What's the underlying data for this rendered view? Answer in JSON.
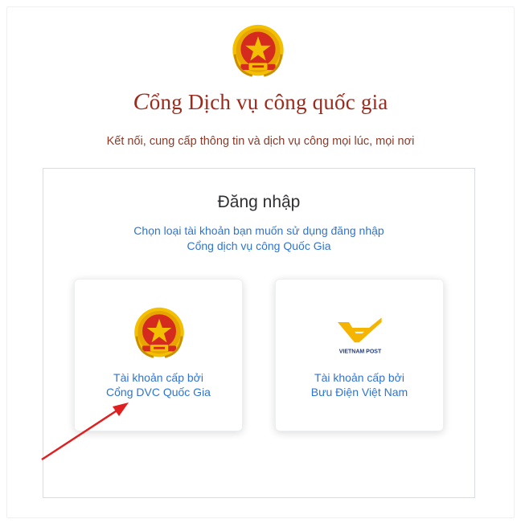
{
  "header": {
    "title": "Cổng Dịch vụ công quốc gia",
    "title_first_letter": "C",
    "title_rest": "ổng Dịch vụ công quốc gia",
    "tagline": "Kết nối, cung cấp thông tin và dịch vụ công mọi lúc, mọi nơi",
    "emblem_icon": "national-emblem-icon"
  },
  "login": {
    "heading": "Đăng nhập",
    "instruction_line1": "Chọn loại tài khoản bạn muốn sử dụng đăng nhập",
    "instruction_line2": "Cổng dịch vụ công Quốc Gia",
    "options": [
      {
        "icon": "national-emblem-icon",
        "label_line1": "Tài khoản cấp bởi",
        "label_line2": "Cổng DVC Quốc Gia"
      },
      {
        "icon": "vietnam-post-logo-icon",
        "logo_text": "VIETNAM POST",
        "label_line1": "Tài khoản cấp bởi",
        "label_line2": "Bưu Điện Việt Nam"
      }
    ]
  },
  "colors": {
    "title": "#9b2b1d",
    "link_blue": "#2f74d0",
    "emblem_red": "#d52b1e",
    "emblem_gold": "#f2c000",
    "vnpost_yellow": "#f5b400",
    "vnpost_navy": "#1e3a78",
    "annotation_red": "#e02020"
  }
}
